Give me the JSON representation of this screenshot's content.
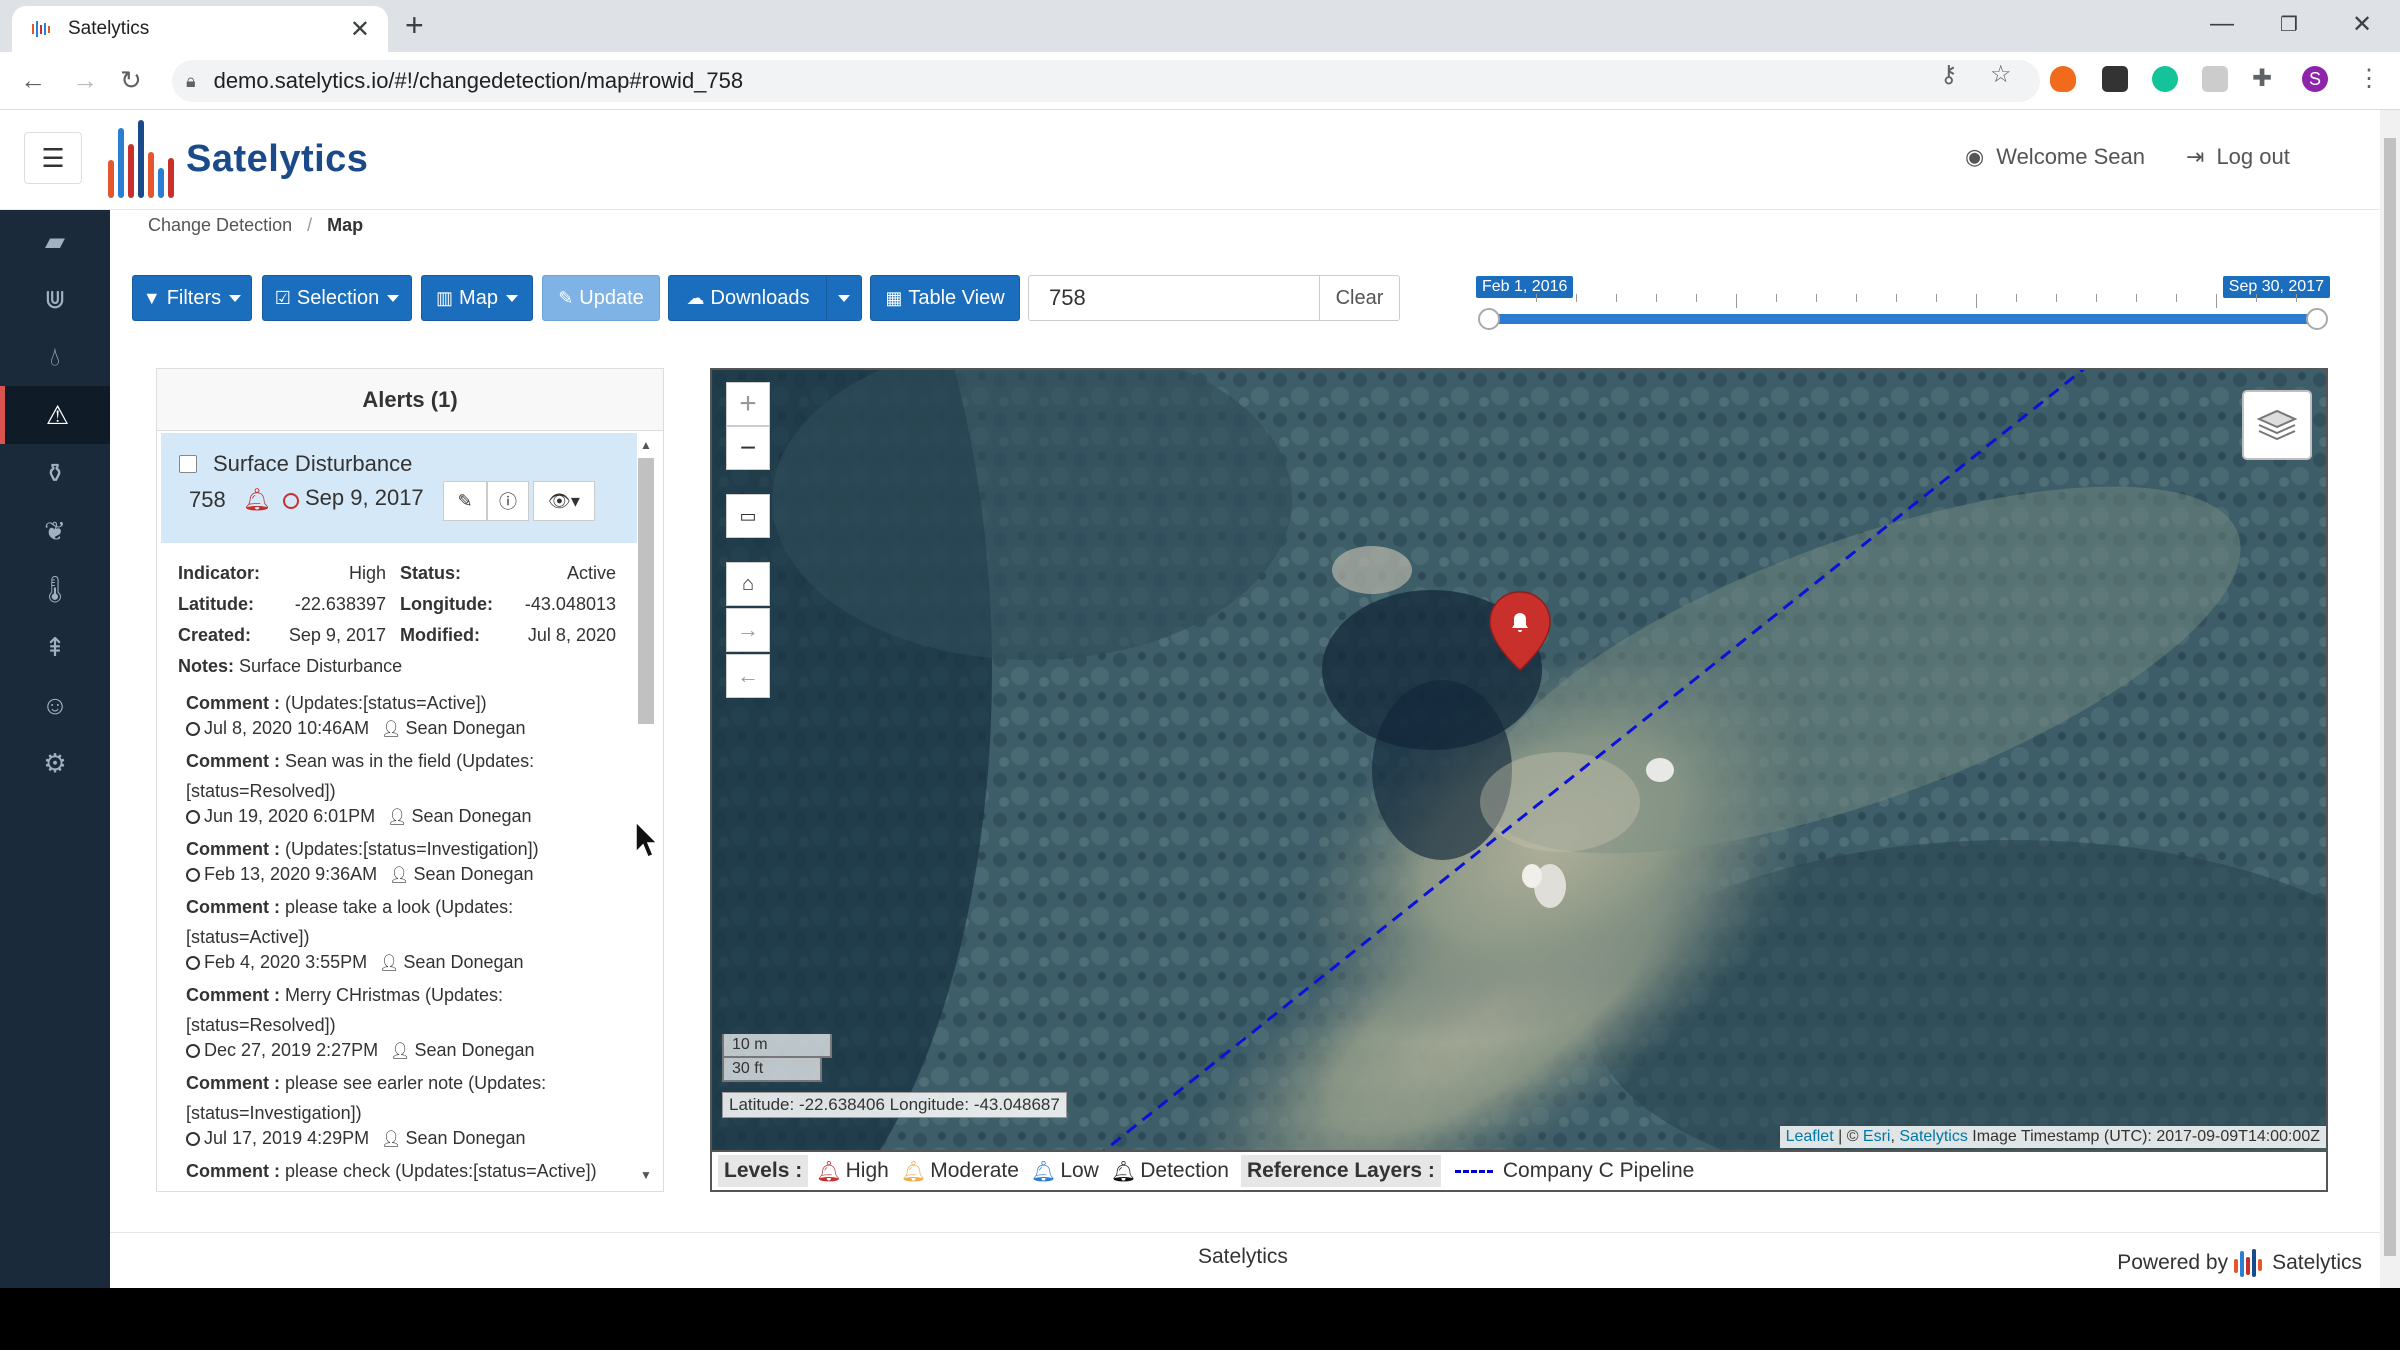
{
  "browser": {
    "tab_title": "Satelytics",
    "url": "demo.satelytics.io/#!/changedetection/map#rowid_758",
    "profile_initial": "S"
  },
  "header": {
    "brand": "Satelytics",
    "welcome": "Welcome Sean",
    "logout": "Log out"
  },
  "breadcrumb": {
    "parent": "Change Detection",
    "sep": "/",
    "current": "Map"
  },
  "toolbar": {
    "filters": "Filters",
    "selection": "Selection",
    "map": "Map",
    "update": "Update",
    "downloads": "Downloads",
    "table_view": "Table View",
    "search_value": "758",
    "clear": "Clear"
  },
  "timeline": {
    "start": "Feb 1, 2016",
    "end": "Sep 30, 2017",
    "range_start_fraction": 0.0,
    "range_end_fraction": 1.0
  },
  "alerts": {
    "title": "Alerts (1)",
    "item": {
      "type": "Surface Disturbance",
      "id": "758",
      "date": "Sep 9, 2017"
    },
    "details": {
      "indicator_label": "Indicator:",
      "indicator": "High",
      "status_label": "Status:",
      "status": "Active",
      "lat_label": "Latitude:",
      "lat": "-22.638397",
      "lon_label": "Longitude:",
      "lon": "-43.048013",
      "created_label": "Created:",
      "created": "Sep 9, 2017",
      "modified_label": "Modified:",
      "modified": "Jul 8, 2020",
      "notes_label": "Notes:",
      "notes": "Surface Disturbance"
    },
    "comment_label": "Comment :",
    "comments": [
      {
        "text": "(Updates:[status=Active])",
        "time": "Jul 8, 2020 10:46AM",
        "user": "Sean Donegan"
      },
      {
        "text": "Sean was in the field (Updates: [status=Resolved])",
        "time": "Jun 19, 2020 6:01PM",
        "user": "Sean Donegan"
      },
      {
        "text": "(Updates:[status=Investigation])",
        "time": "Feb 13, 2020 9:36AM",
        "user": "Sean Donegan"
      },
      {
        "text": "please take a look (Updates: [status=Active])",
        "time": "Feb 4, 2020 3:55PM",
        "user": "Sean Donegan"
      },
      {
        "text": "Merry CHristmas (Updates: [status=Resolved])",
        "time": "Dec 27, 2019 2:27PM",
        "user": "Sean Donegan"
      },
      {
        "text": "please see earler note (Updates: [status=Investigation])",
        "time": "Jul 17, 2019 4:29PM",
        "user": "Sean Donegan"
      },
      {
        "text": "please check (Updates:[status=Active])",
        "time": "",
        "user": ""
      }
    ]
  },
  "map": {
    "zoom_in": "+",
    "zoom_out": "−",
    "scale_m": "10 m",
    "scale_ft": "30 ft",
    "coords": "Latitude: -22.638406 Longitude: -43.048687",
    "attrib_leaflet": "Leaflet",
    "attrib_sep": " | © ",
    "attrib_esri": "Esri",
    "attrib_comma": ", ",
    "attrib_sat": "Satelytics",
    "attrib_ts": " Image Timestamp (UTC): 2017-09-09T14:00:00Z"
  },
  "legend": {
    "levels_label": "Levels :",
    "high": "High",
    "moderate": "Moderate",
    "low": "Low",
    "detection": "Detection",
    "ref_label": "Reference Layers :",
    "pipeline": "Company C Pipeline"
  },
  "footer": {
    "center": "Satelytics",
    "powered": "Powered by",
    "brand": "Satelytics"
  },
  "colors": {
    "primary": "#1b6dbd",
    "sidebar": "#1b2a3a",
    "high": "#c9302c",
    "moderate": "#f0ad4e",
    "low": "#2a7fd4",
    "pipeline": "#0000cc"
  }
}
